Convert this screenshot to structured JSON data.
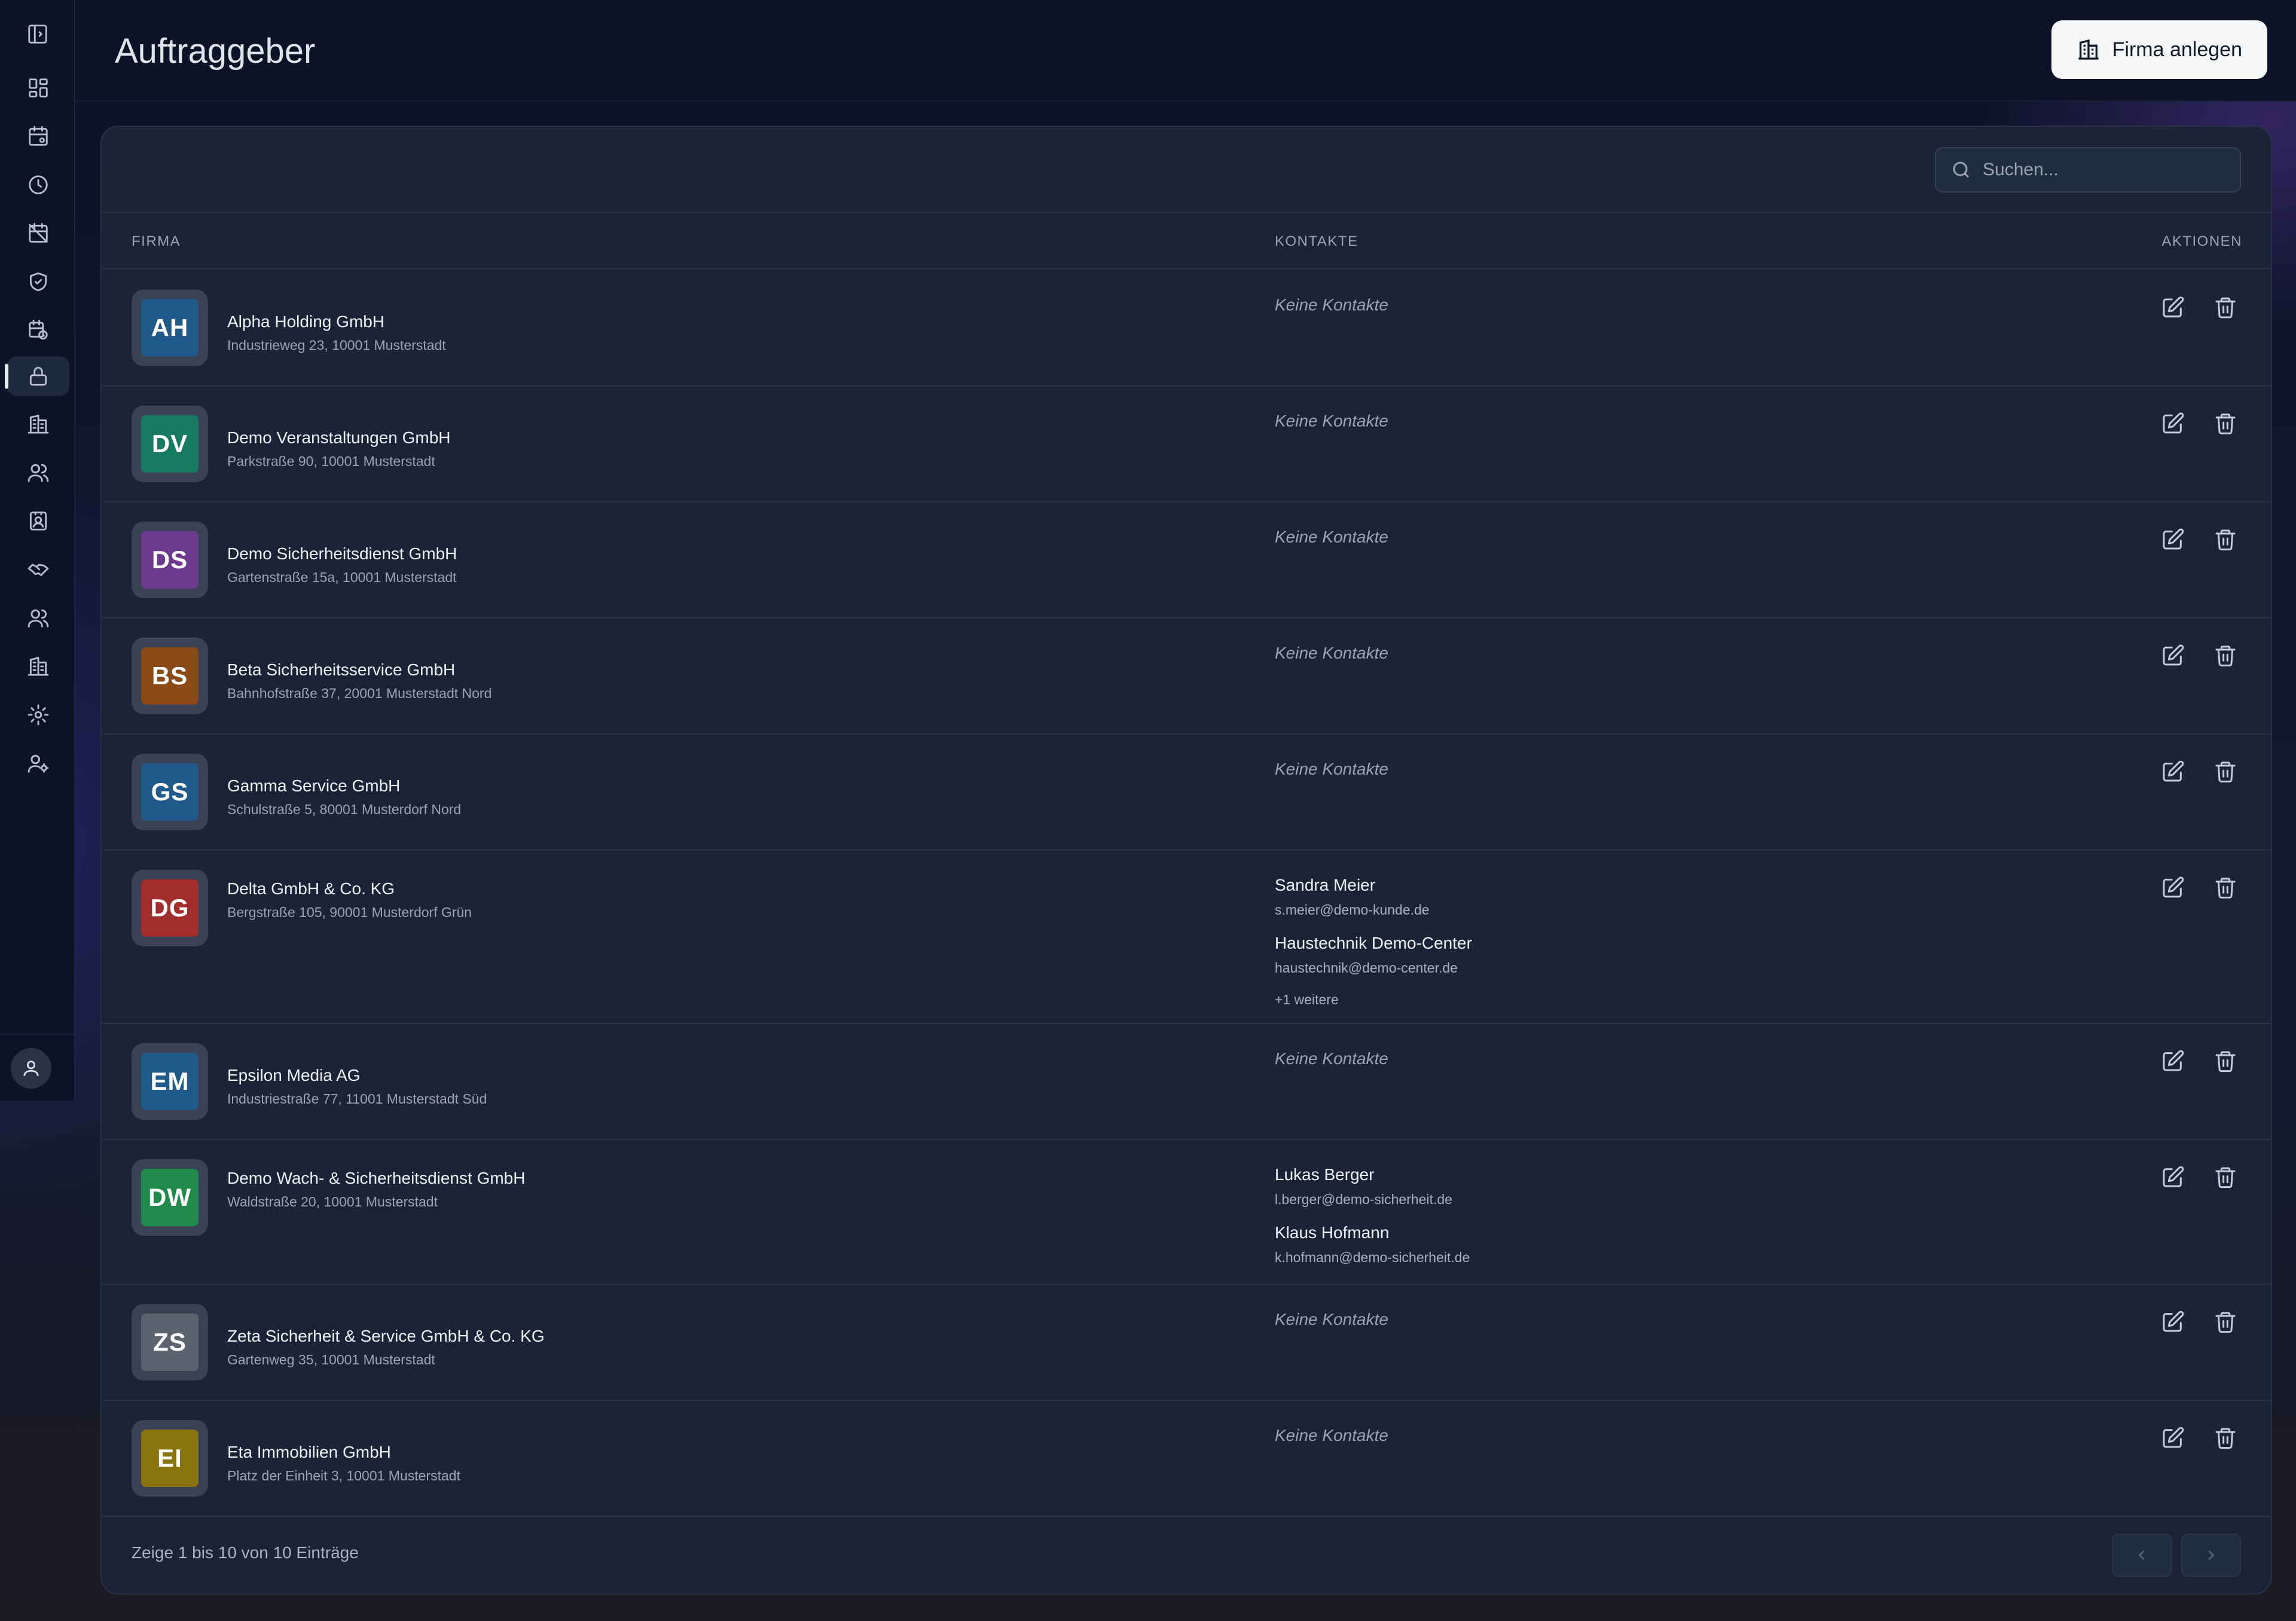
{
  "header": {
    "title": "Auftraggeber",
    "add_button_label": "Firma anlegen"
  },
  "search": {
    "placeholder": "Suchen..."
  },
  "table": {
    "columns": {
      "firma": "FIRMA",
      "kontakte": "KONTAKTE",
      "aktionen": "AKTIONEN"
    },
    "no_contacts_label": "Keine Kontakte",
    "rows": [
      {
        "initials": "AH",
        "color": "#1f5a8a",
        "name": "Alpha Holding GmbH",
        "address": "Industrieweg 23, 10001 Musterstadt"
      },
      {
        "initials": "DV",
        "color": "#177a63",
        "name": "Demo Veranstaltungen GmbH",
        "address": "Parkstraße 90, 10001 Musterstadt"
      },
      {
        "initials": "DS",
        "color": "#6d3a8f",
        "name": "Demo Sicherheitsdienst GmbH",
        "address": "Gartenstraße 15a, 10001 Musterstadt"
      },
      {
        "initials": "BS",
        "color": "#8a4a18",
        "name": "Beta Sicherheitsservice GmbH",
        "address": "Bahnhofstraße 37, 20001 Musterstadt Nord"
      },
      {
        "initials": "GS",
        "color": "#1f5a8a",
        "name": "Gamma Service GmbH",
        "address": "Schulstraße 5, 80001 Musterdorf Nord"
      },
      {
        "initials": "DG",
        "color": "#a12e2c",
        "name": "Delta GmbH & Co. KG",
        "address": "Bergstraße 105, 90001 Musterdorf Grün",
        "contacts": [
          {
            "name": "Sandra Meier",
            "email": "s.meier@demo-kunde.de"
          },
          {
            "name": "Haustechnik Demo-Center",
            "email": "haustechnik@demo-center.de"
          }
        ],
        "more": "+1 weitere"
      },
      {
        "initials": "EM",
        "color": "#1f5a8a",
        "name": "Epsilon Media AG",
        "address": "Industriestraße 77, 11001 Musterstadt Süd"
      },
      {
        "initials": "DW",
        "color": "#1f8a4a",
        "name": "Demo Wach- & Sicherheitsdienst GmbH",
        "address": "Waldstraße 20, 10001 Musterstadt",
        "contacts": [
          {
            "name": "Lukas Berger",
            "email": "l.berger@demo-sicherheit.de"
          },
          {
            "name": "Klaus Hofmann",
            "email": "k.hofmann@demo-sicherheit.de"
          }
        ]
      },
      {
        "initials": "ZS",
        "color": "#5b636e",
        "name": "Zeta Sicherheit & Service GmbH & Co. KG",
        "address": "Gartenweg 35, 10001 Musterstadt"
      },
      {
        "initials": "EI",
        "color": "#8a7410",
        "name": "Eta Immobilien GmbH",
        "address": "Platz der Einheit 3, 10001 Musterstadt"
      }
    ]
  },
  "footer": {
    "summary": "Zeige 1 bis 10 von 10 Einträge"
  },
  "sidebar": {
    "icons": [
      "dashboard-icon",
      "calendar-settings-icon",
      "clock-icon",
      "calendar-off-icon",
      "shield-check-icon",
      "calendar-clock-icon",
      "lock-icon",
      "building-icon",
      "users-icon",
      "contact-card-icon",
      "handshake-icon",
      "users-group-icon",
      "office-building-icon",
      "gear-icon",
      "user-cog-icon"
    ],
    "active_index": 6
  }
}
